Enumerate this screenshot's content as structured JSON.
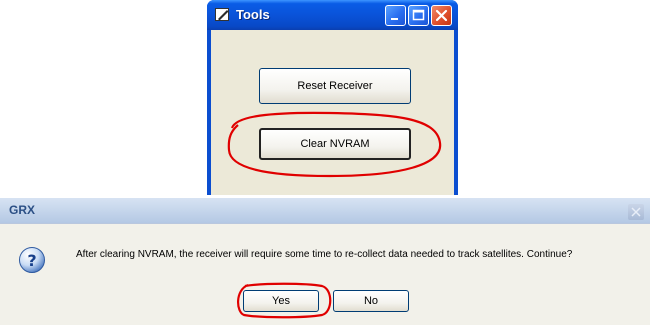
{
  "tools_window": {
    "title": "Tools",
    "buttons": {
      "reset": "Reset Receiver",
      "clear": "Clear NVRAM"
    }
  },
  "dialog": {
    "title": "GRX",
    "message": "After clearing NVRAM, the receiver will require some time to re-collect data needed to track satellites. Continue?",
    "yes_label": "Yes",
    "no_label": "No"
  },
  "colors": {
    "xp_title_blue": "#0a53d9",
    "xp_face": "#ece9d8",
    "annotation_red": "#e00000",
    "dialog_title": "#2b4f85"
  },
  "icons": {
    "tools_app": "pencil-window-icon",
    "question": "question-icon",
    "minimize": "minimize-icon",
    "maximize": "maximize-icon",
    "close": "close-icon"
  }
}
